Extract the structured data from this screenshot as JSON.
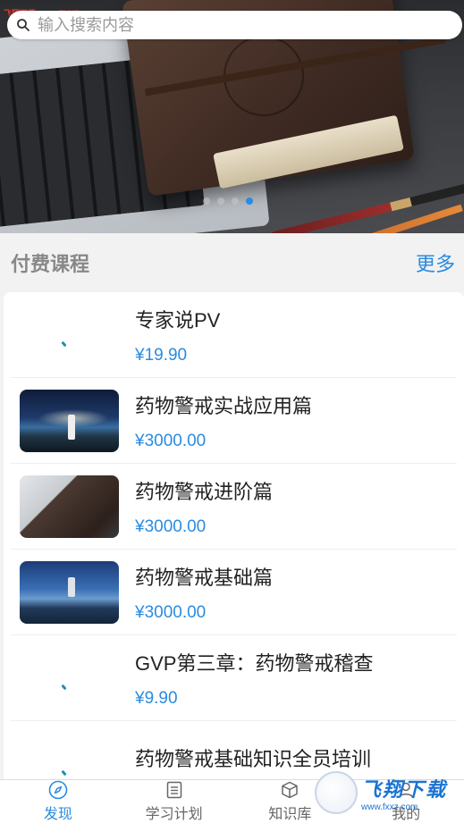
{
  "watermark": "飞翔下载 www.FXXZ.com",
  "search": {
    "placeholder": "输入搜索内容"
  },
  "banner": {
    "slide_count": 4,
    "active_slide": 4
  },
  "section": {
    "title": "付费课程",
    "more": "更多"
  },
  "courses": [
    {
      "title": "专家说PV",
      "price": "¥19.90",
      "thumb": "blank"
    },
    {
      "title": "药物警戒实战应用篇",
      "price": "¥3000.00",
      "thumb": "lighthouse"
    },
    {
      "title": "药物警戒进阶篇",
      "price": "¥3000.00",
      "thumb": "laptop"
    },
    {
      "title": "药物警戒基础篇",
      "price": "¥3000.00",
      "thumb": "sea"
    },
    {
      "title": "GVP第三章：药物警戒稽查",
      "price": "¥9.90",
      "thumb": "blank"
    },
    {
      "title": "药物警戒基础知识全员培训",
      "price": "",
      "thumb": "blank"
    }
  ],
  "tabs": [
    {
      "label": "发现",
      "icon": "compass-icon",
      "active": true
    },
    {
      "label": "学习计划",
      "icon": "list-icon",
      "active": false
    },
    {
      "label": "知识库",
      "icon": "box-icon",
      "active": false
    },
    {
      "label": "我的",
      "icon": "user-icon",
      "active": false
    }
  ],
  "logo": {
    "text": "飞翔下载",
    "sub": "www.fxxz.com"
  },
  "colors": {
    "accent": "#2a8be0",
    "price": "#2a8be0"
  }
}
